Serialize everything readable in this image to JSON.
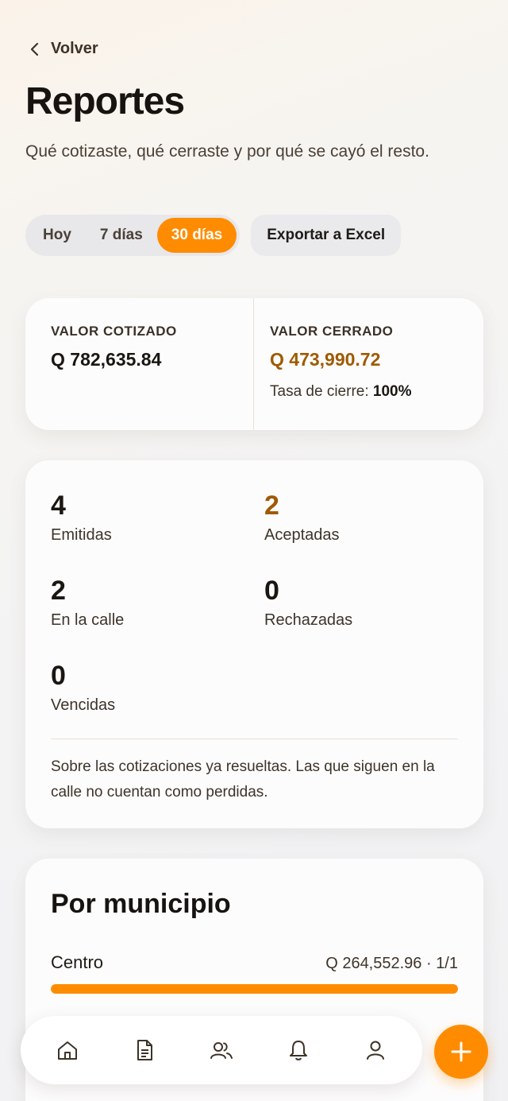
{
  "header": {
    "back_label": "Volver",
    "title": "Reportes",
    "subtitle": "Qué cotizaste, qué cerraste y por qué se cayó el resto."
  },
  "filters": {
    "periods": [
      "Hoy",
      "7 días",
      "30 días"
    ],
    "selected": "30 días",
    "export_label": "Exportar a Excel"
  },
  "summary": {
    "quoted_label": "VALOR COTIZADO",
    "quoted_value": "Q 782,635.84",
    "closed_label": "VALOR CERRADO",
    "closed_value": "Q 473,990.72",
    "rate_label": "Tasa de cierre:",
    "rate_value": "100%"
  },
  "stats": {
    "issued": {
      "value": "4",
      "label": "Emitidas"
    },
    "accepted": {
      "value": "2",
      "label": "Aceptadas"
    },
    "in_street": {
      "value": "2",
      "label": "En la calle"
    },
    "rejected": {
      "value": "0",
      "label": "Rechazadas"
    },
    "expired": {
      "value": "0",
      "label": "Vencidas"
    },
    "note": "Sobre las cotizaciones ya resueltas. Las que siguen en la calle no cuentan como perdidas."
  },
  "municipios": {
    "title": "Por municipio",
    "items": [
      {
        "name": "Centro",
        "value": "Q 264,552.96 · 1/1",
        "fill": 1.0
      }
    ]
  },
  "colors": {
    "accent": "#ff8c00",
    "accent_text": "#9e5a00"
  },
  "nav": {
    "items": [
      "home-icon",
      "document-icon",
      "users-icon",
      "bell-icon",
      "profile-icon"
    ],
    "fab_icon": "plus-icon"
  }
}
